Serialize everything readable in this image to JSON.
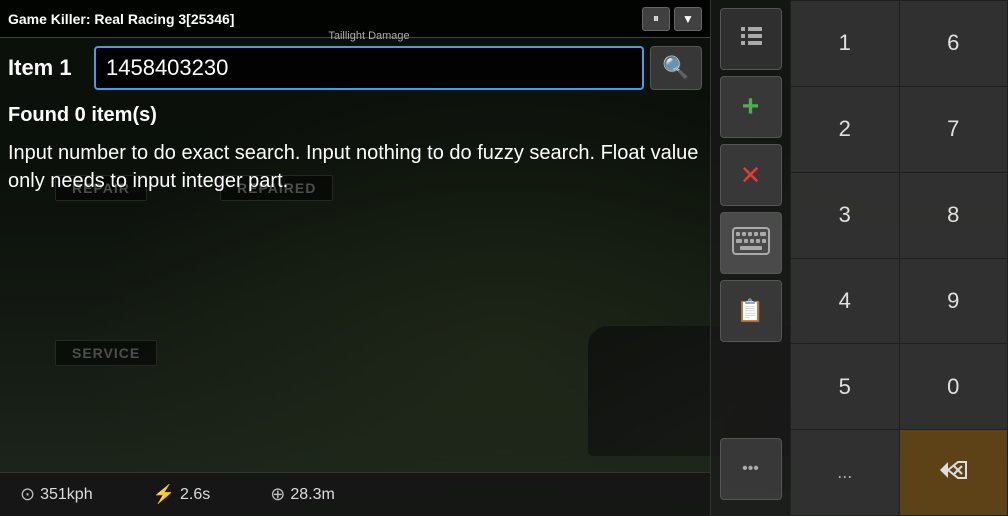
{
  "app": {
    "title": "Game Killer: Real Racing 3[25346]",
    "pause_label": "⏸",
    "dropdown_label": "▼"
  },
  "search": {
    "item_label": "Item",
    "item_number": "1",
    "value": "1458403230",
    "hint": "Taillight Damage",
    "search_icon": "🔍"
  },
  "results": {
    "found_text": "Found 0 item(s)"
  },
  "info": {
    "text": "Input number to do exact search. Input nothing to do fuzzy search. Float value only needs to input integer part."
  },
  "status_bar": {
    "speed": "351kph",
    "time": "2.6s",
    "distance": "28.3m",
    "speed_icon": "⊙",
    "time_icon": "⚡",
    "dist_icon": "⊕"
  },
  "sidebar": {
    "list_icon": "≡",
    "add_icon": "+",
    "delete_icon": "✕",
    "keyboard_icon": "⌨",
    "folder_icon": "📋"
  },
  "numpad": {
    "keys": [
      "1",
      "6",
      "2",
      "7",
      "3",
      "8",
      "4",
      "9",
      "5",
      "0"
    ],
    "dots": "...",
    "backspace": "⏪"
  },
  "repair_labels": {
    "repair": "REPAIR",
    "repaired": "REPAIRED",
    "service": "SERVICE"
  },
  "colors": {
    "accent_blue": "#4a9ae8",
    "add_green": "#4caf50",
    "delete_red": "#e53935",
    "orange_bar": "#b46414"
  }
}
